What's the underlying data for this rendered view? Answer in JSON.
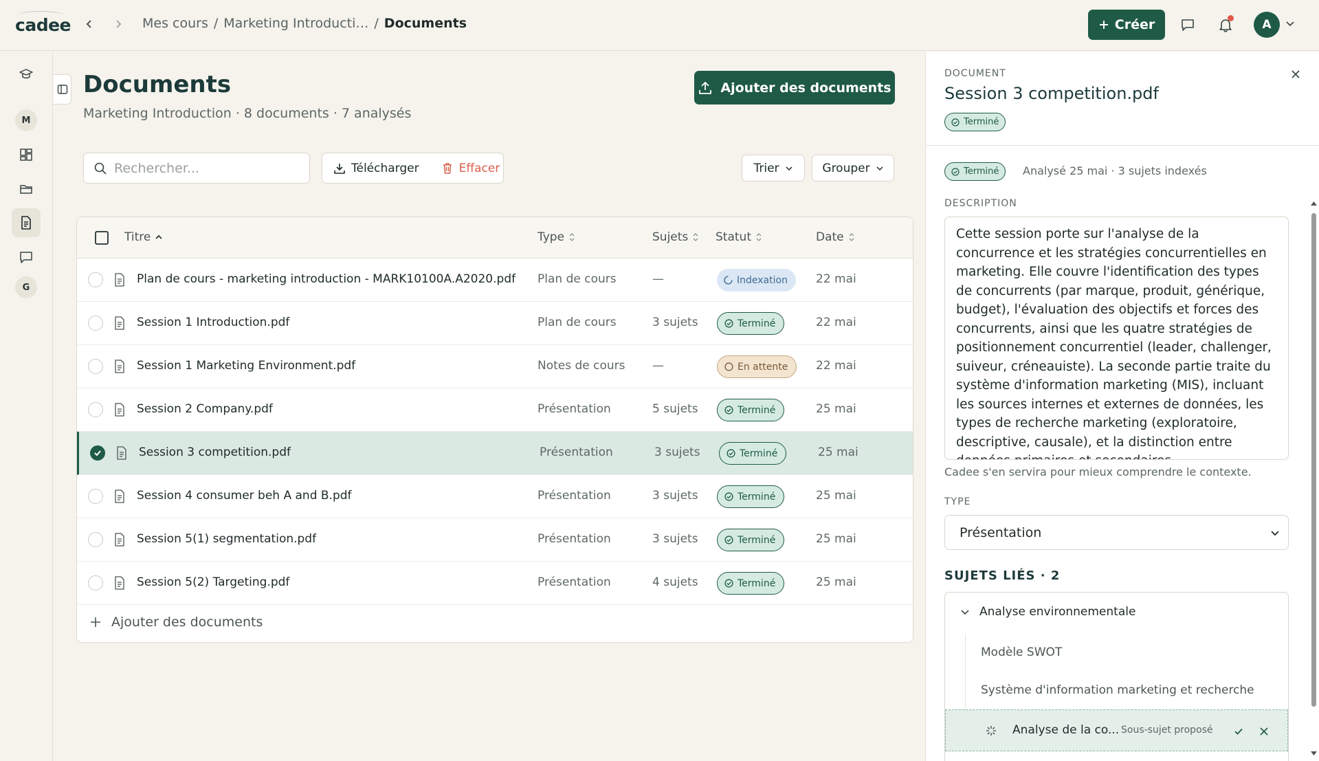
{
  "app": {
    "logo": "cadee"
  },
  "breadcrumb": {
    "part1": "Mes cours",
    "sep1": "/",
    "part2": "Marketing Introducti…",
    "sep2": "/",
    "current": "Documents"
  },
  "topbar": {
    "create_label": "Créer",
    "avatar_initial": "A"
  },
  "rail": {
    "letters": [
      "M",
      "G"
    ]
  },
  "page": {
    "title": "Documents",
    "subtitle": "Marketing Introduction · 8 documents · 7 analysés",
    "add_button": "Ajouter des documents"
  },
  "toolbar": {
    "search_placeholder": "Rechercher...",
    "download_label": "Télécharger",
    "delete_label": "Effacer",
    "sort_label": "Trier",
    "group_label": "Grouper"
  },
  "table": {
    "columns": {
      "title": "Titre",
      "type": "Type",
      "subjects": "Sujets",
      "status": "Statut",
      "date": "Date"
    },
    "rows": [
      {
        "title": "Plan de cours - marketing introduction - MARK10100A.A2020.pdf",
        "type": "Plan de cours",
        "subjects": "—",
        "status": "Indexation",
        "status_kind": "idx",
        "date": "22 mai",
        "selected": false
      },
      {
        "title": "Session 1 Introduction.pdf",
        "type": "Plan de cours",
        "subjects": "3 sujets",
        "status": "Terminé",
        "status_kind": "done",
        "date": "22 mai",
        "selected": false
      },
      {
        "title": "Session 1 Marketing Environment.pdf",
        "type": "Notes de cours",
        "subjects": "—",
        "status": "En attente",
        "status_kind": "wait",
        "date": "22 mai",
        "selected": false
      },
      {
        "title": "Session 2 Company.pdf",
        "type": "Présentation",
        "subjects": "5 sujets",
        "status": "Terminé",
        "status_kind": "done",
        "date": "25 mai",
        "selected": false
      },
      {
        "title": "Session 3 competition.pdf",
        "type": "Présentation",
        "subjects": "3 sujets",
        "status": "Terminé",
        "status_kind": "done",
        "date": "25 mai",
        "selected": true
      },
      {
        "title": "Session 4 consumer beh A and B.pdf",
        "type": "Présentation",
        "subjects": "3 sujets",
        "status": "Terminé",
        "status_kind": "done",
        "date": "25 mai",
        "selected": false
      },
      {
        "title": "Session 5(1) segmentation.pdf",
        "type": "Présentation",
        "subjects": "3 sujets",
        "status": "Terminé",
        "status_kind": "done",
        "date": "25 mai",
        "selected": false
      },
      {
        "title": "Session 5(2) Targeting.pdf",
        "type": "Présentation",
        "subjects": "4 sujets",
        "status": "Terminé",
        "status_kind": "done",
        "date": "25 mai",
        "selected": false
      }
    ],
    "add_row_label": "Ajouter des documents"
  },
  "panel": {
    "eyebrow": "DOCUMENT",
    "title": "Session 3 competition.pdf",
    "status": "Terminé",
    "meta": "Analysé 25 mai · 3 sujets indexés",
    "description_label": "DESCRIPTION",
    "description": "Cette session porte sur l'analyse de la concurrence et les stratégies concurrentielles en marketing. Elle couvre l'identification des types de concurrents (par marque, produit, générique, budget), l'évaluation des objectifs et forces des concurrents, ainsi que les quatre stratégies de positionnement concurrentiel (leader, challenger, suiveur, créneauiste). La seconde partie traite du système d'information marketing (MIS), incluant les sources internes et externes de données, les types de recherche marketing (exploratoire, descriptive, causale), et la distinction entre données primaires et secondaires.",
    "description_help": "Cadee s'en servira pour mieux comprendre le contexte.",
    "type_label": "TYPE",
    "type_value": "Présentation",
    "subjects_title": "SUJETS LIÉS · 2",
    "subjects": {
      "parent": "Analyse environnementale",
      "children": [
        "Modèle SWOT",
        "Système d'information marketing et recherche"
      ],
      "suggestion": {
        "label": "Analyse de la co...",
        "tag": "Sous-sujet proposé"
      }
    }
  },
  "colors": {
    "accent": "#1f5a47",
    "danger": "#d9604c",
    "background": "#f5f3ec"
  }
}
